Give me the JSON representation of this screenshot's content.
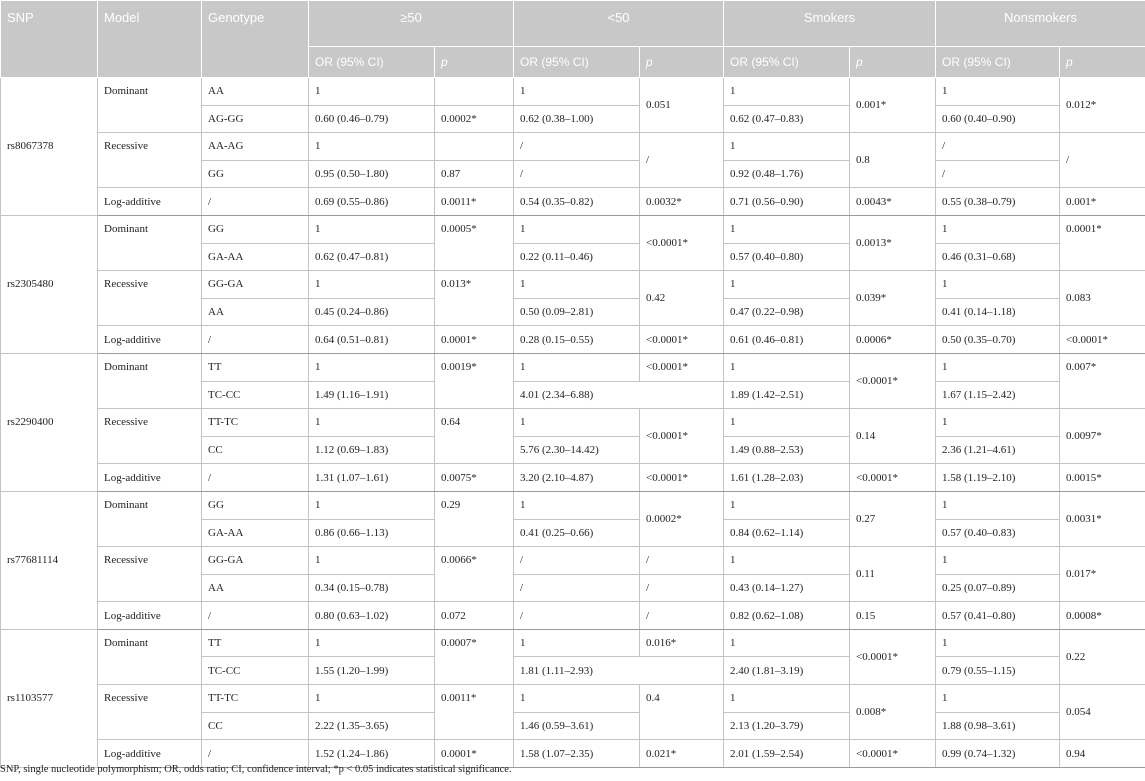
{
  "header": {
    "snp": "SNP",
    "model": "Model",
    "genotype": "Genotype",
    "groups": [
      "≥50",
      "<50",
      "Smokers",
      "Nonsmokers"
    ],
    "or_label": "OR (95% CI)",
    "p_label": "p"
  },
  "rows": {
    "r0": {
      "snp": "rs8067378",
      "model": "Dominant",
      "geno": "AA",
      "or1": "1",
      "p1": "",
      "or2": "1",
      "p2": "0.051",
      "or3": "1",
      "p3": "0.001*",
      "or4": "1",
      "p4": "0.012*"
    },
    "r1": {
      "geno": "AG-GG",
      "or1": "0.60 (0.46–0.79)",
      "p1": "0.0002*",
      "or2": "0.62 (0.38–1.00)",
      "or3": "0.62 (0.47–0.83)",
      "or4": "0.60 (0.40–0.90)"
    },
    "r2": {
      "model": "Recessive",
      "geno": "AA-AG",
      "or1": "1",
      "p1": "",
      "or2": "/",
      "p2": "/",
      "or3": "1",
      "p3": "0.8",
      "or4": "/",
      "p4": "/"
    },
    "r3": {
      "geno": "GG",
      "or1": "0.95 (0.50–1.80)",
      "p1": "0.87",
      "or2": "/",
      "or3": "0.92 (0.48–1.76)",
      "or4": "/"
    },
    "r4": {
      "model": "Log-additive",
      "geno": "/",
      "or1": "0.69 (0.55–0.86)",
      "p1": "0.0011*",
      "or2": "0.54 (0.35–0.82)",
      "p2": "0.0032*",
      "or3": "0.71 (0.56–0.90)",
      "p3": "0.0043*",
      "or4": "0.55 (0.38–0.79)",
      "p4": "0.001*"
    },
    "r5": {
      "snp": "rs2305480",
      "model": "Dominant",
      "geno": "GG",
      "or1": "1",
      "p1": "0.0005*",
      "or2": "1",
      "p2": "<0.0001*",
      "or3": "1",
      "p3": "0.0013*",
      "or4": "1",
      "p4": "0.0001*"
    },
    "r6": {
      "geno": "GA-AA",
      "or1": "0.62 (0.47–0.81)",
      "or2": "0.22 (0.11–0.46)",
      "or3": "0.57 (0.40–0.80)",
      "or4": "0.46 (0.31–0.68)"
    },
    "r7": {
      "model": "Recessive",
      "geno": "GG-GA",
      "or1": "1",
      "p1": "0.013*",
      "or2": "1",
      "p2": "0.42",
      "or3": "1",
      "p3": "0.039*",
      "or4": "1",
      "p4": "0.083"
    },
    "r8": {
      "geno": "AA",
      "or1": "0.45 (0.24–0.86)",
      "or2": "0.50 (0.09–2.81)",
      "or3": "0.47 (0.22–0.98)",
      "or4": "0.41 (0.14–1.18)"
    },
    "r9": {
      "model": "Log-additive",
      "geno": "/",
      "or1": "0.64 (0.51–0.81)",
      "p1": "0.0001*",
      "or2": "0.28 (0.15–0.55)",
      "p2": "<0.0001*",
      "or3": "0.61 (0.46–0.81)",
      "p3": "0.0006*",
      "or4": "0.50 (0.35–0.70)",
      "p4": "<0.0001*"
    },
    "r10": {
      "snp": "rs2290400",
      "model": "Dominant",
      "geno": "TT",
      "or1": "1",
      "p1": "0.0019*",
      "or2": "1",
      "p2": "<0.0001*",
      "or3": "1",
      "p3": "<0.0001*",
      "or4": "1",
      "p4": "0.007*"
    },
    "r11": {
      "geno": "TC-CC",
      "or1": "1.49 (1.16–1.91)",
      "or2": "4.01 (2.34–6.88)",
      "or3": "1.89 (1.42–2.51)",
      "or4": "1.67 (1.15–2.42)"
    },
    "r12": {
      "model": "Recessive",
      "geno": "TT-TC",
      "or1": "1",
      "p1": "0.64",
      "or2": "1",
      "p2": "<0.0001*",
      "or3": "1",
      "p3": "0.14",
      "or4": "1",
      "p4": "0.0097*"
    },
    "r13": {
      "geno": "CC",
      "or1": "1.12 (0.69–1.83)",
      "or2": "5.76 (2.30–14.42)",
      "or3": "1.49 (0.88–2.53)",
      "or4": "2.36 (1.21–4.61)"
    },
    "r14": {
      "model": "Log-additive",
      "geno": "/",
      "or1": "1.31 (1.07–1.61)",
      "p1": "0.0075*",
      "or2": "3.20 (2.10–4.87)",
      "p2": "<0.0001*",
      "or3": "1.61 (1.28–2.03)",
      "p3": "<0.0001*",
      "or4": "1.58 (1.19–2.10)",
      "p4": "0.0015*"
    },
    "r15": {
      "snp": "rs77681114",
      "model": "Dominant",
      "geno": "GG",
      "or1": "1",
      "p1": "0.29",
      "or2": "1",
      "p2": "0.0002*",
      "or3": "1",
      "p3": "0.27",
      "or4": "1",
      "p4": "0.0031*"
    },
    "r16": {
      "geno": "GA-AA",
      "or1": "0.86 (0.66–1.13)",
      "or2": "0.41 (0.25–0.66)",
      "or3": "0.84 (0.62–1.14)",
      "or4": "0.57 (0.40–0.83)"
    },
    "r17": {
      "model": "Recessive",
      "geno": "GG-GA",
      "or1": "1",
      "p1": "0.0066*",
      "or2": "/",
      "p2": "/",
      "or3": "1",
      "p3": "0.11",
      "or4": "1",
      "p4": "0.017*"
    },
    "r18": {
      "geno": "AA",
      "or1": "0.34 (0.15–0.78)",
      "or2": "/",
      "p2": "/",
      "or3": "0.43 (0.14–1.27)",
      "or4": "0.25 (0.07–0.89)"
    },
    "r19": {
      "model": "Log-additive",
      "geno": "/",
      "or1": "0.80 (0.63–1.02)",
      "p1": "0.072",
      "or2": "/",
      "p2": "/",
      "or3": "0.82 (0.62–1.08)",
      "p3": "0.15",
      "or4": "0.57 (0.41–0.80)",
      "p4": "0.0008*"
    },
    "r20": {
      "snp": "rs1103577",
      "model": "Dominant",
      "geno": "TT",
      "or1": "1",
      "p1": "0.0007*",
      "or2": "1",
      "p2": "0.016*",
      "or3": "1",
      "p3": "<0.0001*",
      "or4": "1",
      "p4": "0.22"
    },
    "r21": {
      "geno": "TC-CC",
      "or1": "1.55 (1.20–1.99)",
      "or2": "1.81 (1.11–2.93)",
      "or3": "2.40 (1.81–3.19)",
      "or4": "0.79 (0.55–1.15)"
    },
    "r22": {
      "model": "Recessive",
      "geno": "TT-TC",
      "or1": "1",
      "p1": "0.0011*",
      "or2": "1",
      "p2": "0.4",
      "or3": "1",
      "p3": "0.008*",
      "or4": "1",
      "p4": "0.054"
    },
    "r23": {
      "geno": "CC",
      "or1": "2.22 (1.35–3.65)",
      "or2": "1.46 (0.59–3.61)",
      "or3": "2.13 (1.20–3.79)",
      "or4": "1.88 (0.98–3.61)"
    },
    "r24": {
      "model": "Log-additive",
      "geno": "/",
      "or1": "1.52 (1.24–1.86)",
      "p1": "0.0001*",
      "or2": "1.58 (1.07–2.35)",
      "p2": "0.021*",
      "or3": "2.01 (1.59–2.54)",
      "p3": "<0.0001*",
      "or4": "0.99 (0.74–1.32)",
      "p4": "0.94"
    }
  },
  "footnote": "SNP, single nucleotide polymorphism; OR, odds ratio; CI, confidence interval; *p < 0.05 indicates statistical significance."
}
